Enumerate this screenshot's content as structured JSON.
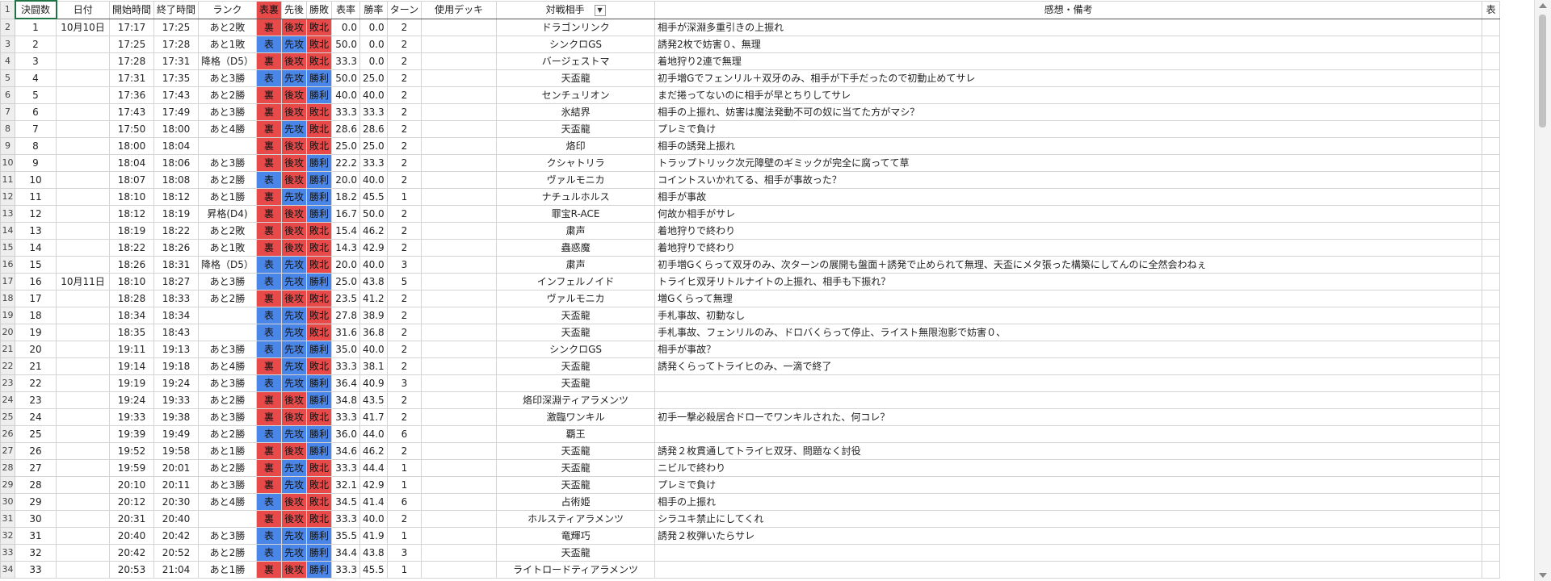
{
  "headers": {
    "rownum": "1",
    "no": "決闘数",
    "date": "日付",
    "start": "開始時間",
    "end": "終了時間",
    "rank": "ランク",
    "omoteura": "表裏",
    "senkou": "先後",
    "result": "勝敗",
    "omote_rate": "表率",
    "win_rate": "勝率",
    "turn": "ターン",
    "deck": "使用デッキ",
    "opponent": "対戦相手",
    "notes": "感想・備考",
    "extra": "表"
  },
  "colors": {
    "red": "#e84a4a",
    "blue": "#4a86e8"
  },
  "rows": [
    {
      "rn": "2",
      "no": "1",
      "date": "10月10日",
      "start": "17:17",
      "end": "17:25",
      "rank": "あと2敗",
      "ou": "裏",
      "sg": "後攻",
      "res": "敗北",
      "or": "0.0",
      "wr": "0.0",
      "turn": "2",
      "deck": "",
      "opp": "ドラゴンリンク",
      "note": "相手が深淵多重引きの上振れ"
    },
    {
      "rn": "3",
      "no": "2",
      "date": "",
      "start": "17:25",
      "end": "17:28",
      "rank": "あと1敗",
      "ou": "表",
      "sg": "先攻",
      "res": "敗北",
      "or": "50.0",
      "wr": "0.0",
      "turn": "2",
      "deck": "",
      "opp": "シンクロGS",
      "note": "誘発2枚で妨害０、無理"
    },
    {
      "rn": "4",
      "no": "3",
      "date": "",
      "start": "17:28",
      "end": "17:31",
      "rank": "降格（D5）",
      "ou": "裏",
      "sg": "後攻",
      "res": "敗北",
      "or": "33.3",
      "wr": "0.0",
      "turn": "2",
      "deck": "",
      "opp": "バージェストマ",
      "note": "着地狩り2連で無理"
    },
    {
      "rn": "5",
      "no": "4",
      "date": "",
      "start": "17:31",
      "end": "17:35",
      "rank": "あと3勝",
      "ou": "表",
      "sg": "先攻",
      "res": "勝利",
      "or": "50.0",
      "wr": "25.0",
      "turn": "2",
      "deck": "",
      "opp": "天盃龍",
      "note": "初手増Gでフェンリル＋双牙のみ、相手が下手だったので初動止めてサレ"
    },
    {
      "rn": "6",
      "no": "5",
      "date": "",
      "start": "17:36",
      "end": "17:43",
      "rank": "あと2勝",
      "ou": "裏",
      "sg": "後攻",
      "res": "勝利",
      "or": "40.0",
      "wr": "40.0",
      "turn": "2",
      "deck": "",
      "opp": "センチュリオン",
      "note": "まだ捲ってないのに相手が早とちりしてサレ"
    },
    {
      "rn": "7",
      "no": "6",
      "date": "",
      "start": "17:43",
      "end": "17:49",
      "rank": "あと3勝",
      "ou": "裏",
      "sg": "後攻",
      "res": "敗北",
      "or": "33.3",
      "wr": "33.3",
      "turn": "2",
      "deck": "",
      "opp": "氷結界",
      "note": "相手の上振れ、妨害は魔法発動不可の奴に当てた方がマシ？"
    },
    {
      "rn": "8",
      "no": "7",
      "date": "",
      "start": "17:50",
      "end": "18:00",
      "rank": "あと4勝",
      "ou": "裏",
      "sg": "先攻",
      "res": "敗北",
      "or": "28.6",
      "wr": "28.6",
      "turn": "2",
      "deck": "",
      "opp": "天盃龍",
      "note": "プレミで負け"
    },
    {
      "rn": "9",
      "no": "8",
      "date": "",
      "start": "18:00",
      "end": "18:04",
      "rank": "",
      "ou": "裏",
      "sg": "後攻",
      "res": "敗北",
      "or": "25.0",
      "wr": "25.0",
      "turn": "2",
      "deck": "",
      "opp": "烙印",
      "note": "相手の誘発上振れ"
    },
    {
      "rn": "10",
      "no": "9",
      "date": "",
      "start": "18:04",
      "end": "18:06",
      "rank": "あと3勝",
      "ou": "裏",
      "sg": "後攻",
      "res": "勝利",
      "or": "22.2",
      "wr": "33.3",
      "turn": "2",
      "deck": "",
      "opp": "クシャトリラ",
      "note": "トラップトリック次元障壁のギミックが完全に腐ってて草"
    },
    {
      "rn": "11",
      "no": "10",
      "date": "",
      "start": "18:07",
      "end": "18:08",
      "rank": "あと2勝",
      "ou": "表",
      "sg": "後攻",
      "res": "勝利",
      "or": "20.0",
      "wr": "40.0",
      "turn": "2",
      "deck": "",
      "opp": "ヴァルモニカ",
      "note": "コイントスいかれてる、相手が事故った？"
    },
    {
      "rn": "12",
      "no": "11",
      "date": "",
      "start": "18:10",
      "end": "18:12",
      "rank": "あと1勝",
      "ou": "裏",
      "sg": "先攻",
      "res": "勝利",
      "or": "18.2",
      "wr": "45.5",
      "turn": "1",
      "deck": "",
      "opp": "ナチュルホルス",
      "note": "相手が事故"
    },
    {
      "rn": "13",
      "no": "12",
      "date": "",
      "start": "18:12",
      "end": "18:19",
      "rank": "昇格(D4)",
      "ou": "裏",
      "sg": "後攻",
      "res": "勝利",
      "or": "16.7",
      "wr": "50.0",
      "turn": "2",
      "deck": "",
      "opp": "罪宝R-ACE",
      "note": "何故か相手がサレ"
    },
    {
      "rn": "14",
      "no": "13",
      "date": "",
      "start": "18:19",
      "end": "18:22",
      "rank": "あと2敗",
      "ou": "裏",
      "sg": "後攻",
      "res": "敗北",
      "or": "15.4",
      "wr": "46.2",
      "turn": "2",
      "deck": "",
      "opp": "粛声",
      "note": "着地狩りで終わり"
    },
    {
      "rn": "15",
      "no": "14",
      "date": "",
      "start": "18:22",
      "end": "18:26",
      "rank": "あと1敗",
      "ou": "裏",
      "sg": "後攻",
      "res": "敗北",
      "or": "14.3",
      "wr": "42.9",
      "turn": "2",
      "deck": "",
      "opp": "蟲惑魔",
      "note": "着地狩りで終わり"
    },
    {
      "rn": "16",
      "no": "15",
      "date": "",
      "start": "18:26",
      "end": "18:31",
      "rank": "降格（D5）",
      "ou": "表",
      "sg": "先攻",
      "res": "敗北",
      "or": "20.0",
      "wr": "40.0",
      "turn": "3",
      "deck": "",
      "opp": "粛声",
      "note": "初手増Gくらって双牙のみ、次ターンの展開も盤面＋誘発で止められて無理、天盃にメタ張った構築にしてんのに全然会わねぇ"
    },
    {
      "rn": "17",
      "no": "16",
      "date": "10月11日",
      "start": "18:10",
      "end": "18:27",
      "rank": "あと3勝",
      "ou": "表",
      "sg": "先攻",
      "res": "勝利",
      "or": "25.0",
      "wr": "43.8",
      "turn": "5",
      "deck": "",
      "opp": "インフェルノイド",
      "note": "トライヒ双牙リトルナイトの上振れ、相手も下振れ？"
    },
    {
      "rn": "18",
      "no": "17",
      "date": "",
      "start": "18:28",
      "end": "18:33",
      "rank": "あと2勝",
      "ou": "裏",
      "sg": "後攻",
      "res": "敗北",
      "or": "23.5",
      "wr": "41.2",
      "turn": "2",
      "deck": "",
      "opp": "ヴァルモニカ",
      "note": "増Gくらって無理"
    },
    {
      "rn": "19",
      "no": "18",
      "date": "",
      "start": "18:34",
      "end": "18:34",
      "rank": "",
      "ou": "表",
      "sg": "先攻",
      "res": "敗北",
      "or": "27.8",
      "wr": "38.9",
      "turn": "2",
      "deck": "",
      "opp": "天盃龍",
      "note": "手札事故、初動なし"
    },
    {
      "rn": "20",
      "no": "19",
      "date": "",
      "start": "18:35",
      "end": "18:43",
      "rank": "",
      "ou": "表",
      "sg": "先攻",
      "res": "敗北",
      "or": "31.6",
      "wr": "36.8",
      "turn": "2",
      "deck": "",
      "opp": "天盃龍",
      "note": "手札事故、フェンリルのみ、ドロバくらって停止、ライスト無限泡影で妨害０、"
    },
    {
      "rn": "21",
      "no": "20",
      "date": "",
      "start": "19:11",
      "end": "19:13",
      "rank": "あと3勝",
      "ou": "表",
      "sg": "先攻",
      "res": "勝利",
      "or": "35.0",
      "wr": "40.0",
      "turn": "2",
      "deck": "",
      "opp": "シンクロGS",
      "note": "相手が事故？"
    },
    {
      "rn": "22",
      "no": "21",
      "date": "",
      "start": "19:14",
      "end": "19:18",
      "rank": "あと4勝",
      "ou": "裏",
      "sg": "先攻",
      "res": "敗北",
      "or": "33.3",
      "wr": "38.1",
      "turn": "2",
      "deck": "",
      "opp": "天盃龍",
      "note": "誘発くらってトライヒのみ、一滴で終了"
    },
    {
      "rn": "23",
      "no": "22",
      "date": "",
      "start": "19:19",
      "end": "19:24",
      "rank": "あと3勝",
      "ou": "表",
      "sg": "先攻",
      "res": "勝利",
      "or": "36.4",
      "wr": "40.9",
      "turn": "3",
      "deck": "",
      "opp": "天盃龍",
      "note": ""
    },
    {
      "rn": "24",
      "no": "23",
      "date": "",
      "start": "19:24",
      "end": "19:33",
      "rank": "あと2勝",
      "ou": "裏",
      "sg": "後攻",
      "res": "勝利",
      "or": "34.8",
      "wr": "43.5",
      "turn": "2",
      "deck": "",
      "opp": "烙印深淵ティアラメンツ",
      "note": ""
    },
    {
      "rn": "25",
      "no": "24",
      "date": "",
      "start": "19:33",
      "end": "19:38",
      "rank": "あと3勝",
      "ou": "裏",
      "sg": "後攻",
      "res": "敗北",
      "or": "33.3",
      "wr": "41.7",
      "turn": "2",
      "deck": "",
      "opp": "激臨ワンキル",
      "note": "初手一撃必殺居合ドローでワンキルされた、何コレ？"
    },
    {
      "rn": "26",
      "no": "25",
      "date": "",
      "start": "19:39",
      "end": "19:49",
      "rank": "あと2勝",
      "ou": "表",
      "sg": "先攻",
      "res": "勝利",
      "or": "36.0",
      "wr": "44.0",
      "turn": "6",
      "deck": "",
      "opp": "覇王",
      "note": ""
    },
    {
      "rn": "27",
      "no": "26",
      "date": "",
      "start": "19:52",
      "end": "19:58",
      "rank": "あと1勝",
      "ou": "裏",
      "sg": "後攻",
      "res": "勝利",
      "or": "34.6",
      "wr": "46.2",
      "turn": "2",
      "deck": "",
      "opp": "天盃龍",
      "note": "誘発２枚貫通してトライヒ双牙、問題なく討役"
    },
    {
      "rn": "28",
      "no": "27",
      "date": "",
      "start": "19:59",
      "end": "20:01",
      "rank": "あと2勝",
      "ou": "裏",
      "sg": "先攻",
      "res": "敗北",
      "or": "33.3",
      "wr": "44.4",
      "turn": "1",
      "deck": "",
      "opp": "天盃龍",
      "note": "ニビルで終わり"
    },
    {
      "rn": "29",
      "no": "28",
      "date": "",
      "start": "20:10",
      "end": "20:11",
      "rank": "あと3勝",
      "ou": "裏",
      "sg": "先攻",
      "res": "敗北",
      "or": "32.1",
      "wr": "42.9",
      "turn": "1",
      "deck": "",
      "opp": "天盃龍",
      "note": "プレミで負け"
    },
    {
      "rn": "30",
      "no": "29",
      "date": "",
      "start": "20:12",
      "end": "20:30",
      "rank": "あと4勝",
      "ou": "表",
      "sg": "後攻",
      "res": "敗北",
      "or": "34.5",
      "wr": "41.4",
      "turn": "6",
      "deck": "",
      "opp": "占術姫",
      "note": "相手の上振れ"
    },
    {
      "rn": "31",
      "no": "30",
      "date": "",
      "start": "20:31",
      "end": "20:40",
      "rank": "",
      "ou": "裏",
      "sg": "後攻",
      "res": "敗北",
      "or": "33.3",
      "wr": "40.0",
      "turn": "2",
      "deck": "",
      "opp": "ホルスティアラメンツ",
      "note": "シラユキ禁止にしてくれ"
    },
    {
      "rn": "32",
      "no": "31",
      "date": "",
      "start": "20:40",
      "end": "20:42",
      "rank": "あと3勝",
      "ou": "表",
      "sg": "先攻",
      "res": "勝利",
      "or": "35.5",
      "wr": "41.9",
      "turn": "1",
      "deck": "",
      "opp": "竜輝巧",
      "note": "誘発２枚弾いたらサレ"
    },
    {
      "rn": "33",
      "no": "32",
      "date": "",
      "start": "20:42",
      "end": "20:52",
      "rank": "あと2勝",
      "ou": "表",
      "sg": "先攻",
      "res": "勝利",
      "or": "34.4",
      "wr": "43.8",
      "turn": "3",
      "deck": "",
      "opp": "天盃龍",
      "note": ""
    },
    {
      "rn": "34",
      "no": "33",
      "date": "",
      "start": "20:53",
      "end": "21:04",
      "rank": "あと1勝",
      "ou": "裏",
      "sg": "後攻",
      "res": "勝利",
      "or": "33.3",
      "wr": "45.5",
      "turn": "1",
      "deck": "",
      "opp": "ライトロードティアラメンツ",
      "note": ""
    }
  ]
}
